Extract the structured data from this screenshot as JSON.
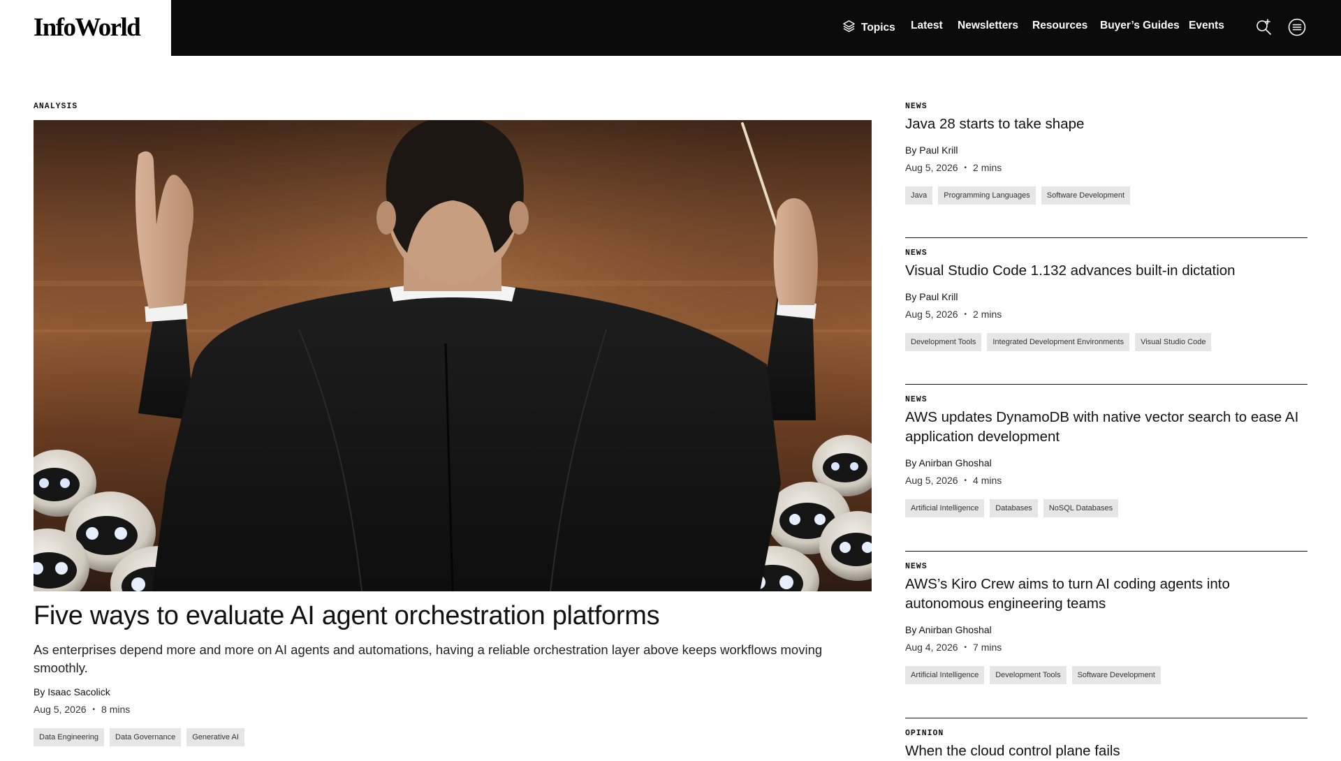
{
  "header": {
    "logo": "InfoWorld",
    "nav": [
      {
        "label": "Topics",
        "icon": "layers-icon"
      },
      {
        "label": "Latest"
      },
      {
        "label": "Newsletters"
      },
      {
        "label": "Resources"
      },
      {
        "label": "Buyer’s Guides"
      },
      {
        "label": "Events"
      }
    ],
    "icons": [
      "search-sparkle-icon",
      "menu-icon"
    ]
  },
  "feature": {
    "kicker": "ANALYSIS",
    "image_alt": "Conductor in a black suit facing rows of small white robots",
    "title": "Five ways to evaluate AI agent orchestration platforms",
    "dek": "As enterprises depend more and more on AI agents and automations, having a reliable orchestration layer above keeps workflows moving smoothly.",
    "byline": "By Isaac Sacolick",
    "date": "Aug 5, 2026",
    "read_time": "8 mins",
    "tags": [
      "Data Engineering",
      "Data Governance",
      "Generative AI"
    ]
  },
  "sidebar": [
    {
      "kicker": "NEWS",
      "title": "Java 28 starts to take shape",
      "byline": "By Paul Krill",
      "date": "Aug 5, 2026",
      "read_time": "2 mins",
      "tags": [
        "Java",
        "Programming Languages",
        "Software Development"
      ]
    },
    {
      "kicker": "NEWS",
      "title": "Visual Studio Code 1.132 advances built-in dictation",
      "byline": "By Paul Krill",
      "date": "Aug 5, 2026",
      "read_time": "2 mins",
      "tags": [
        "Development Tools",
        "Integrated Development Environments",
        "Visual Studio Code"
      ]
    },
    {
      "kicker": "NEWS",
      "title": "AWS updates DynamoDB with native vector search to ease AI application development",
      "byline": "By Anirban Ghoshal",
      "date": "Aug 5, 2026",
      "read_time": "4 mins",
      "tags": [
        "Artificial Intelligence",
        "Databases",
        "NoSQL Databases"
      ]
    },
    {
      "kicker": "NEWS",
      "title": "AWS’s Kiro Crew aims to turn AI coding agents into autonomous engineering teams",
      "byline": "By Anirban Ghoshal",
      "date": "Aug 4, 2026",
      "read_time": "7 mins",
      "tags": [
        "Artificial Intelligence",
        "Development Tools",
        "Software Development"
      ]
    },
    {
      "kicker": "OPINION",
      "title": "When the cloud control plane fails"
    }
  ],
  "colors": {
    "header_bg": "#0b0b0b",
    "tag_bg": "#e6e6e6"
  }
}
